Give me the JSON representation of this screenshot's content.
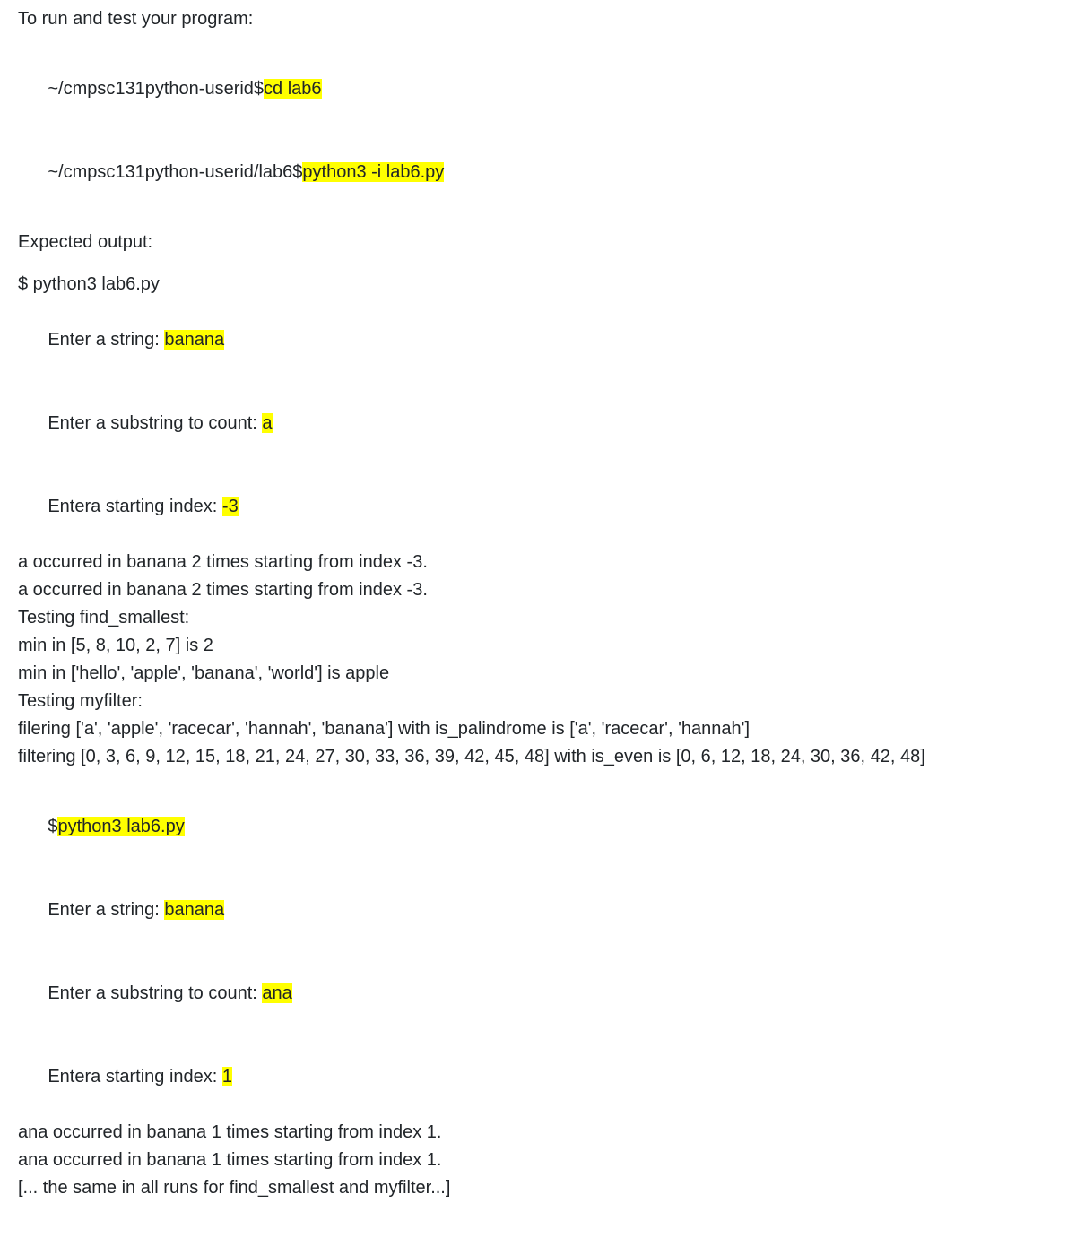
{
  "intro": "To run and test your program:",
  "cmd1": {
    "prompt": "~/cmpsc131python-userid$",
    "cmd": "cd lab6"
  },
  "cmd2": {
    "prompt": "~/cmpsc131python-userid/lab6$",
    "cmd": "python3 -i lab6.py"
  },
  "expected_label": "Expected output:",
  "run1": {
    "invoke": "$ python3 lab6.py",
    "l1a": "Enter a string: ",
    "l1b": "banana",
    "l2a": "Enter a substring to count: ",
    "l2b": "a",
    "l3a": "Entera starting index: ",
    "l3b": "-3",
    "l4": "a occurred in banana 2 times starting from index -3.",
    "l5": "a occurred in banana 2 times starting from index -3.",
    "l6": "Testing find_smallest:",
    "l7": "min in [5, 8, 10, 2, 7] is 2",
    "l8": "min in ['hello', 'apple', 'banana', 'world'] is apple",
    "l9": "Testing myfilter:",
    "l10": "filering ['a', 'apple', 'racecar', 'hannah', 'banana'] with is_palindrome is ['a', 'racecar', 'hannah']",
    "l11": "filtering [0, 3, 6, 9, 12, 15, 18, 21, 24, 27, 30, 33, 36, 39, 42, 45, 48] with is_even is [0, 6, 12, 18, 24, 30, 36, 42, 48]"
  },
  "run2": {
    "invoke_a": "$",
    "invoke_b": "python3 lab6.py",
    "l1a": "Enter a string: ",
    "l1b": "banana",
    "l2a": "Enter a substring to count: ",
    "l2b": "ana",
    "l3a": "Entera starting index: ",
    "l3b": "1",
    "l4": "ana occurred in banana 1 times starting from index 1.",
    "l5": "ana occurred in banana 1 times starting from index 1.",
    "l6": "[... the same in all runs for find_smallest and myfilter...]"
  }
}
